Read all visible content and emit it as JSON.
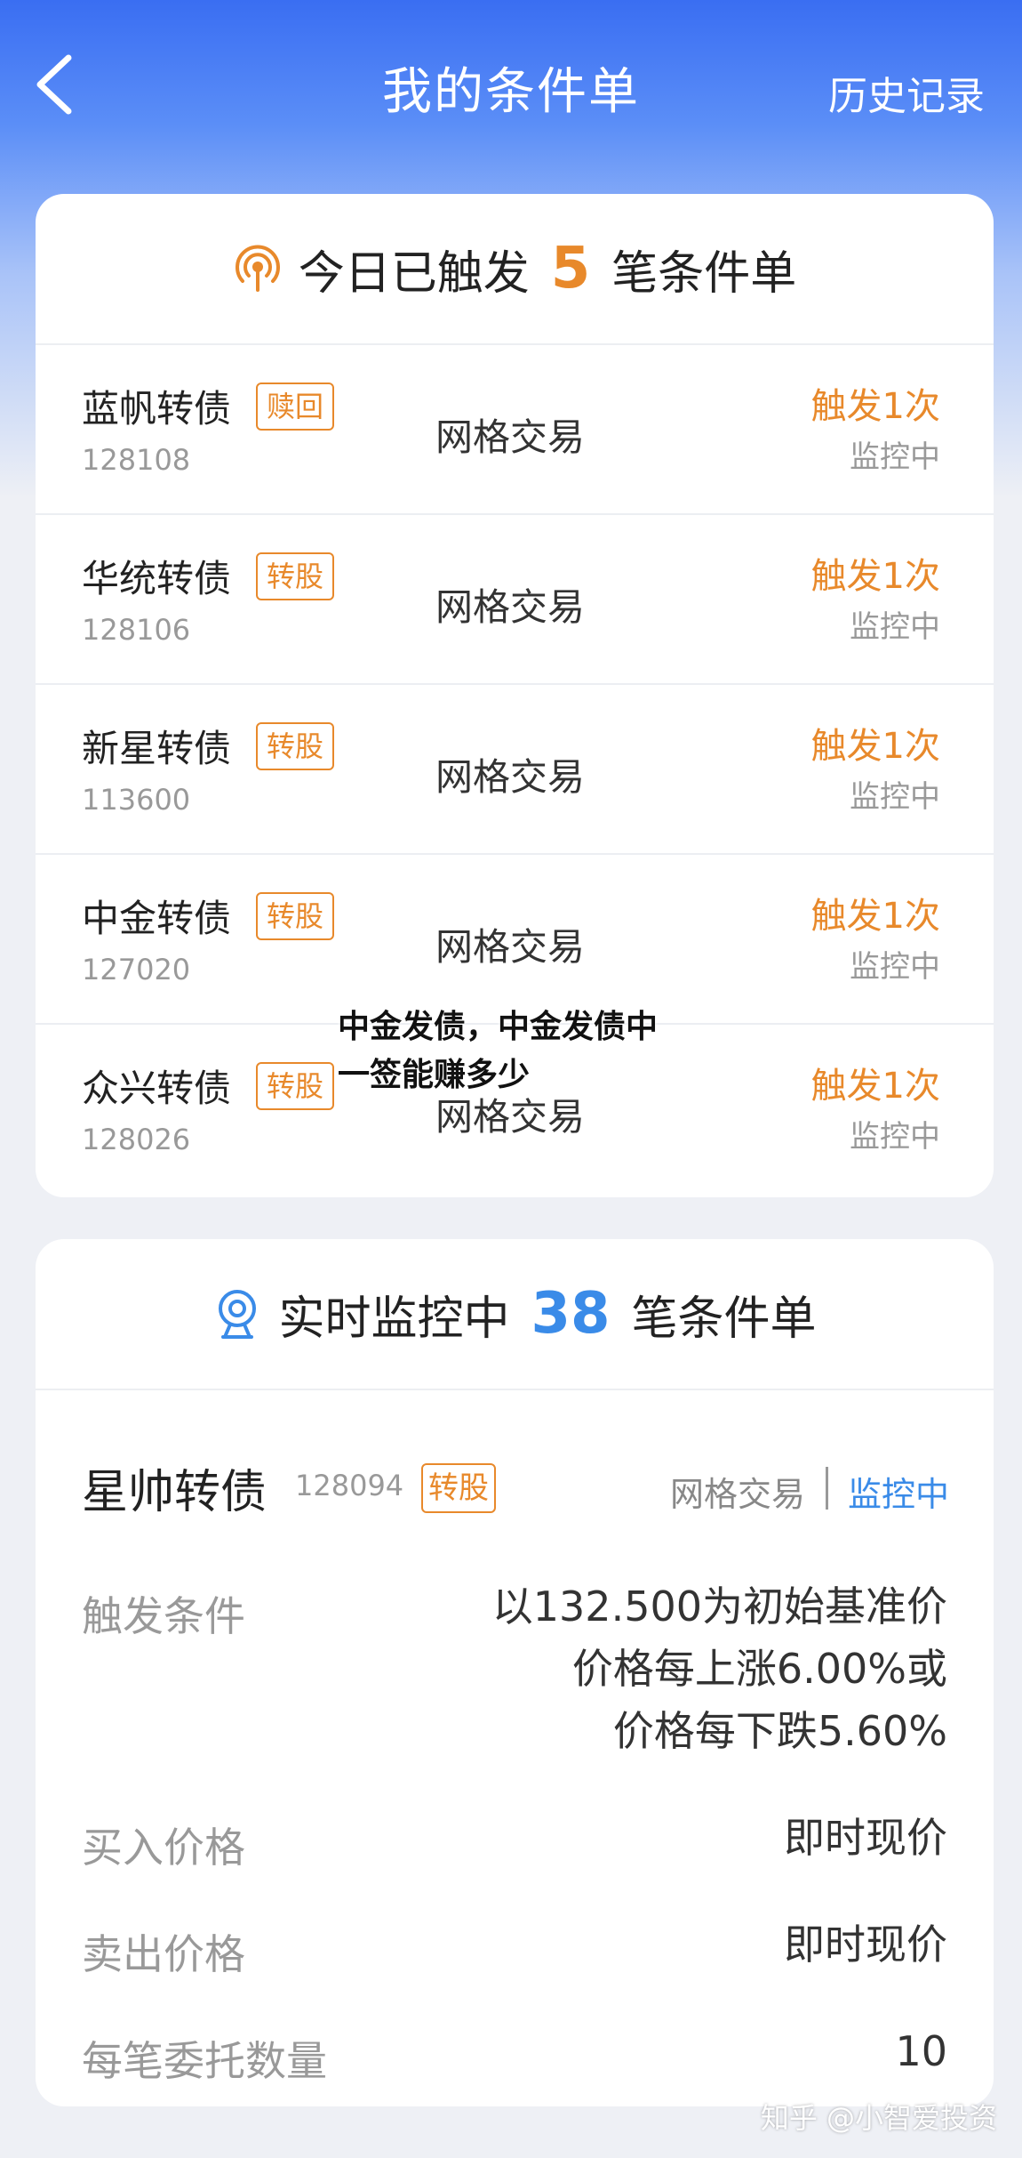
{
  "nav": {
    "title": "我的条件单",
    "history_label": "历史记录"
  },
  "triggered_card": {
    "prefix": "今日已触发",
    "count": "5",
    "suffix": "笔条件单",
    "accent_color": "#e8892b",
    "rows": [
      {
        "name": "蓝帆转债",
        "tag": "赎回",
        "code": "128108",
        "type": "网格交易",
        "trigger": "触发1次",
        "status": "监控中"
      },
      {
        "name": "华统转债",
        "tag": "转股",
        "code": "128106",
        "type": "网格交易",
        "trigger": "触发1次",
        "status": "监控中"
      },
      {
        "name": "新星转债",
        "tag": "转股",
        "code": "113600",
        "type": "网格交易",
        "trigger": "触发1次",
        "status": "监控中"
      },
      {
        "name": "中金转债",
        "tag": "转股",
        "code": "127020",
        "type": "网格交易",
        "trigger": "触发1次",
        "status": "监控中"
      },
      {
        "name": "众兴转债",
        "tag": "转股",
        "code": "128026",
        "type": "网格交易",
        "trigger": "触发1次",
        "status": "监控中"
      }
    ]
  },
  "monitor_card": {
    "prefix": "实时监控中",
    "count": "38",
    "suffix": "笔条件单",
    "accent_color": "#3a8be8",
    "detail": {
      "name": "星帅转债",
      "code": "128094",
      "tag": "转股",
      "type": "网格交易",
      "status": "监控中",
      "trigger_label": "触发条件",
      "trigger_lines": [
        "以132.500为初始基准价",
        "价格每上涨6.00%或",
        "价格每下跌5.60%"
      ],
      "buy_label": "买入价格",
      "buy_value": "即时现价",
      "sell_label": "卖出价格",
      "sell_value": "即时现价",
      "qty_label": "每笔委托数量",
      "qty_value": "10"
    }
  },
  "overlay": {
    "line1": "中金发债，中金发债中",
    "line2": "一签能赚多少"
  },
  "brand": "知乎 @小智爱投资"
}
